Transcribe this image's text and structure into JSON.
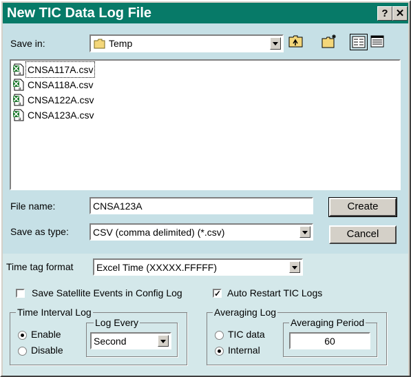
{
  "window": {
    "title": "New TIC Data Log File",
    "help_label": "?",
    "close_label": "✕"
  },
  "save_in": {
    "label": "Save in:",
    "value": "Temp"
  },
  "toolbar": {
    "icons": [
      "up-folder-icon",
      "new-folder-icon",
      "list-view-icon",
      "details-view-icon"
    ]
  },
  "files": [
    {
      "name": "CNSA117A.csv",
      "selected": true
    },
    {
      "name": "CNSA118A.csv",
      "selected": false
    },
    {
      "name": "CNSA122A.csv",
      "selected": false
    },
    {
      "name": "CNSA123A.csv",
      "selected": false
    }
  ],
  "file_name": {
    "label": "File name:",
    "value": "CNSA123A"
  },
  "save_as_type": {
    "label": "Save as type:",
    "value": "CSV (comma delimited) (*.csv)"
  },
  "buttons": {
    "create": "Create",
    "cancel": "Cancel"
  },
  "time_tag": {
    "label": "Time tag format",
    "value": "Excel Time (XXXXX.FFFFF)"
  },
  "options": {
    "save_satellite_events": {
      "label": "Save Satellite Events in Config Log",
      "checked": false
    },
    "auto_restart": {
      "label": "Auto Restart TIC Logs",
      "checked": true
    }
  },
  "time_interval": {
    "title": "Time Interval Log",
    "enable": "Enable",
    "disable": "Disable",
    "selected": "enable",
    "log_every": {
      "title": "Log Every",
      "value": "Second"
    }
  },
  "averaging": {
    "title": "Averaging Log",
    "tic_data": "TIC data",
    "internal": "Internal",
    "selected": "internal",
    "period": {
      "title": "Averaging Period",
      "value": "60"
    }
  },
  "colors": {
    "title_bar": "#077a68",
    "dialog_bg": "#c6e0e6",
    "options_bg": "#d4e8ea"
  }
}
